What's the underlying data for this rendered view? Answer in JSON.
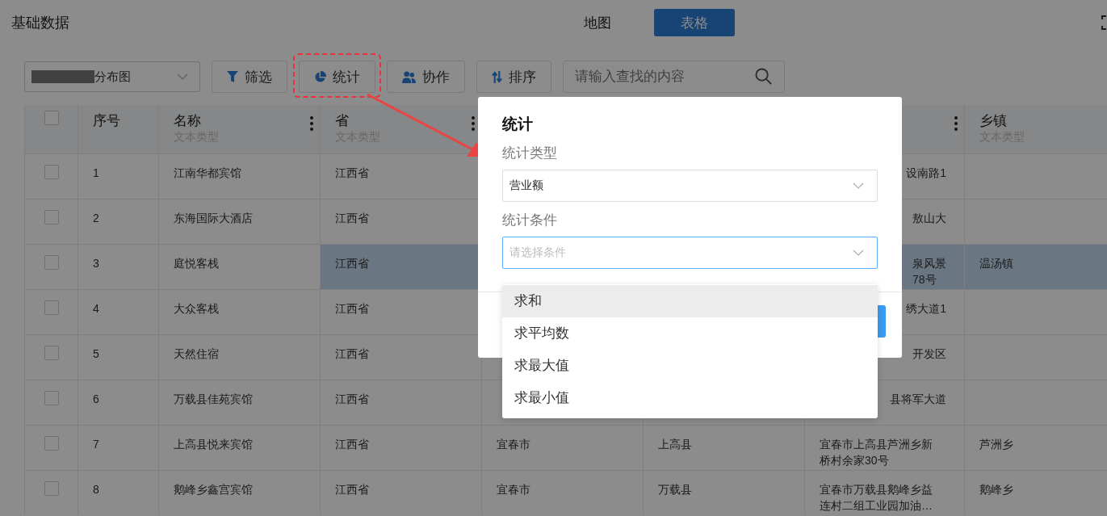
{
  "page_title": "基础数据",
  "view_tabs": [
    {
      "label": "地图",
      "selected": false
    },
    {
      "label": "表格",
      "selected": true
    }
  ],
  "toolbar": {
    "layer_select": {
      "value": "分布图"
    },
    "buttons": [
      {
        "label": "筛选",
        "kind": "filter"
      },
      {
        "label": "统计",
        "kind": "stats"
      },
      {
        "label": "协作",
        "kind": "team"
      },
      {
        "label": "排序",
        "kind": "sort"
      }
    ],
    "search": {
      "placeholder": "请输入查找的内容"
    }
  },
  "table": {
    "all_checked": false,
    "columns": [
      {
        "label": "序号"
      },
      {
        "label": "名称",
        "type": "文本类型",
        "menu": true
      },
      {
        "label": "省",
        "type": "文本类型",
        "menu": true
      },
      {},
      {},
      {
        "menu": true
      },
      {
        "label": "乡镇",
        "type": "文本类型"
      }
    ],
    "rows": [
      {
        "checked": false,
        "selected": false,
        "kind": "covered",
        "cells": [
          "1",
          "江南华都宾馆",
          "江西省",
          null,
          null,
          "设南路1",
          null
        ]
      },
      {
        "checked": false,
        "selected": false,
        "kind": "covered",
        "cells": [
          "2",
          "东海国际大酒店",
          "江西省",
          null,
          null,
          "敖山大",
          null
        ]
      },
      {
        "checked": false,
        "selected": true,
        "kind": "covered",
        "cells": [
          "3",
          "庭悦客栈",
          "江西省",
          null,
          null,
          "泉风景\n78号",
          "温汤镇"
        ]
      },
      {
        "checked": false,
        "selected": false,
        "kind": "covered",
        "cells": [
          "4",
          "大众客栈",
          "江西省",
          null,
          null,
          "绣大道1",
          null
        ]
      },
      {
        "checked": false,
        "selected": false,
        "kind": "covered",
        "cells": [
          "5",
          "天然住宿",
          "江西省",
          null,
          null,
          "开发区",
          null
        ]
      },
      {
        "checked": false,
        "selected": false,
        "kind": "covered",
        "cells": [
          "6",
          "万载县佳苑宾馆",
          "江西省",
          null,
          null,
          "县将军大道",
          null
        ]
      },
      {
        "checked": false,
        "selected": false,
        "kind": "full",
        "cells": [
          "7",
          "上高县悦来宾馆",
          "江西省",
          "宜春市",
          "上高县",
          "宜春市上高县芦洲乡新桥村余家30号",
          "芦洲乡"
        ]
      },
      {
        "checked": false,
        "selected": false,
        "kind": "full",
        "cells": [
          "8",
          "鹅峰乡鑫宫宾馆",
          "江西省",
          "宜春市",
          "万载县",
          "宜春市万载县鹅峰乡益连村二组工业园加油…",
          "鹅峰乡"
        ]
      }
    ]
  },
  "dialog": {
    "title": "统计",
    "fields": [
      {
        "label": "统计类型",
        "value": "营业额",
        "focused": false
      },
      {
        "label": "统计条件",
        "placeholder": "请选择条件",
        "focused": true
      }
    ],
    "options": [
      {
        "label": "求和",
        "highlighted": true
      },
      {
        "label": "求平均数",
        "highlighted": false
      },
      {
        "label": "求最大值",
        "highlighted": false
      },
      {
        "label": "求最小值",
        "highlighted": false
      }
    ]
  }
}
